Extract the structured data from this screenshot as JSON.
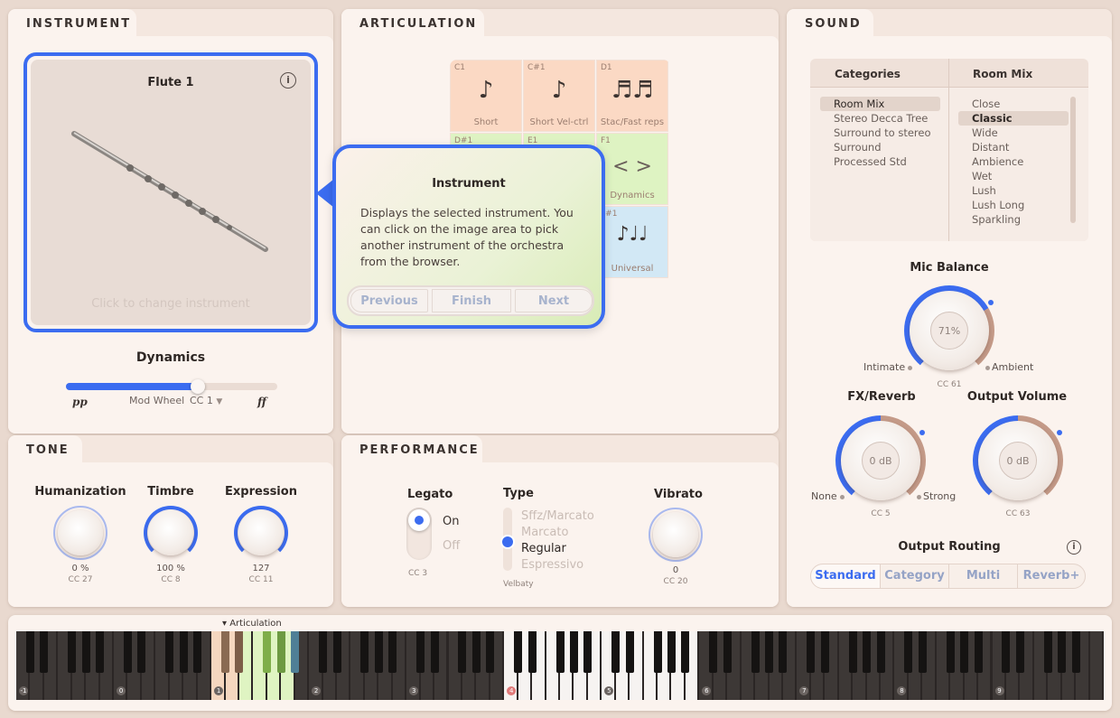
{
  "instrument": {
    "tab": "INSTRUMENT",
    "name": "Flute 1",
    "hint": "Click to change instrument",
    "dynamics_label": "Dynamics",
    "pp": "pp",
    "ff": "ff",
    "mod_wheel": "Mod Wheel",
    "cc": "CC 1",
    "dynamics_value": 0.62
  },
  "tone": {
    "tab": "TONE",
    "knobs": [
      {
        "label": "Humanization",
        "value": "0 %",
        "cc": "CC 27"
      },
      {
        "label": "Timbre",
        "value": "100 %",
        "cc": "CC 8"
      },
      {
        "label": "Expression",
        "value": "127",
        "cc": "CC 11"
      }
    ]
  },
  "articulation": {
    "tab": "ARTICULATION",
    "cells": [
      {
        "note": "C1",
        "name": "Short",
        "glyph": "♪"
      },
      {
        "note": "C#1",
        "name": "Short Vel-ctrl",
        "glyph": "♪"
      },
      {
        "note": "D1",
        "name": "Stac/Fast reps",
        "glyph": "♬♬"
      },
      {
        "note": "D#1",
        "name": "",
        "glyph": ""
      },
      {
        "note": "E1",
        "name": "",
        "glyph": ""
      },
      {
        "note": "F1",
        "name": "Dynamics",
        "glyph": "< >"
      },
      {
        "note": "F#1",
        "name": "Universal",
        "glyph": "♪♩♩"
      }
    ]
  },
  "tooltip": {
    "title": "Instrument",
    "body": "Displays the selected instrument. You can click on the image area to pick another instrument of the orchestra from the browser.",
    "prev": "Previous",
    "finish": "Finish",
    "next": "Next"
  },
  "performance": {
    "tab": "PERFORMANCE",
    "legato_label": "Legato",
    "legato_on": "On",
    "legato_off": "Off",
    "legato_cc": "CC 3",
    "type_label": "Type",
    "types": [
      "Sffz/Marcato",
      "Marcato",
      "Regular",
      "Espressivo"
    ],
    "type_selected": "Regular",
    "type_sub": "Velbaty",
    "vibrato_label": "Vibrato",
    "vibrato_value": "0",
    "vibrato_cc": "CC 20"
  },
  "sound": {
    "tab": "SOUND",
    "categories_header": "Categories",
    "categories": [
      "Room Mix",
      "Stereo Decca Tree",
      "Surround to stereo",
      "Surround",
      "Processed Std"
    ],
    "categories_selected": "Room Mix",
    "roommix_header": "Room Mix",
    "roommix": [
      "Close",
      "Classic",
      "Wide",
      "Distant",
      "Ambience",
      "Wet",
      "Lush",
      "Lush Long",
      "Sparkling"
    ],
    "roommix_selected": "Classic",
    "mic_balance_label": "Mic Balance",
    "mic_value": "71%",
    "mic_left": "Intimate",
    "mic_right": "Ambient",
    "mic_cc": "CC 61",
    "fx_label": "FX/Reverb",
    "fx_value": "0 dB",
    "fx_left": "None",
    "fx_right": "Strong",
    "fx_cc": "CC 5",
    "out_label": "Output Volume",
    "out_value": "0 dB",
    "out_cc": "CC 63",
    "routing_label": "Output Routing",
    "routing": [
      "Standard",
      "Category",
      "Multi",
      "Reverb+"
    ],
    "routing_selected": "Standard"
  },
  "keyboard": {
    "label": "▾ Articulation",
    "octaves": [
      "-1",
      "0",
      "1",
      "2",
      "3",
      "4",
      "5",
      "6",
      "7",
      "8",
      "9"
    ]
  },
  "colors": {
    "accent": "#3b6cf0",
    "panel": "#fbf3ee",
    "art_orange": "#fbd9c4",
    "art_green": "#def3c2",
    "art_blue": "#d2e8f5"
  }
}
